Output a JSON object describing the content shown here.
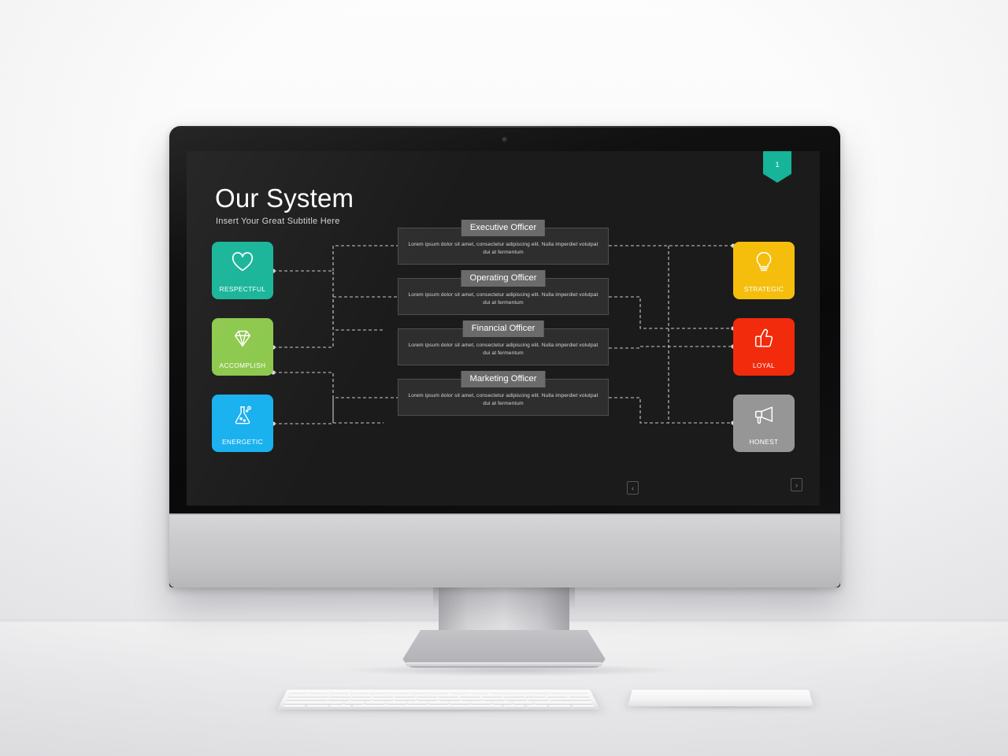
{
  "slide": {
    "title": "Our System",
    "subtitle": "Insert Your Great Subtitle Here",
    "badge_number": "1",
    "background_color": "#1b1b1b",
    "nav": {
      "prev_label": "‹",
      "next_label": "›"
    }
  },
  "left_cards": [
    {
      "label": "RESPECTFUL",
      "icon": "heart-icon",
      "color": "#16b498"
    },
    {
      "label": "ACCOMPLISH",
      "icon": "diamond-icon",
      "color": "#8cc84b"
    },
    {
      "label": "ENERGETIC",
      "icon": "flask-icon",
      "color": "#17b0ef"
    }
  ],
  "right_cards": [
    {
      "label": "STRATEGIC",
      "icon": "lightbulb-icon",
      "color": "#f5be0d"
    },
    {
      "label": "LOYAL",
      "icon": "thumbs-up-icon",
      "color": "#f22b0c"
    },
    {
      "label": "HONEST",
      "icon": "megaphone-icon",
      "color": "#969696"
    }
  ],
  "officers": [
    {
      "title": "Executive Officer",
      "body": "Lorem ipsum dolor sit amet, consectetur adipiscing elit. Nulla imperdiet volutpat dui at fermentum"
    },
    {
      "title": "Operating Officer",
      "body": "Lorem ipsum dolor sit amet, consectetur adipiscing elit. Nulla imperdiet volutpat dui at fermentum"
    },
    {
      "title": "Financial Officer",
      "body": "Lorem ipsum dolor sit amet, consectetur adipiscing elit. Nulla imperdiet volutpat dui at fermentum"
    },
    {
      "title": "Marketing Officer",
      "body": "Lorem ipsum dolor sit amet, consectetur adipiscing elit. Nulla imperdiet volutpat dui at fermentum"
    }
  ]
}
